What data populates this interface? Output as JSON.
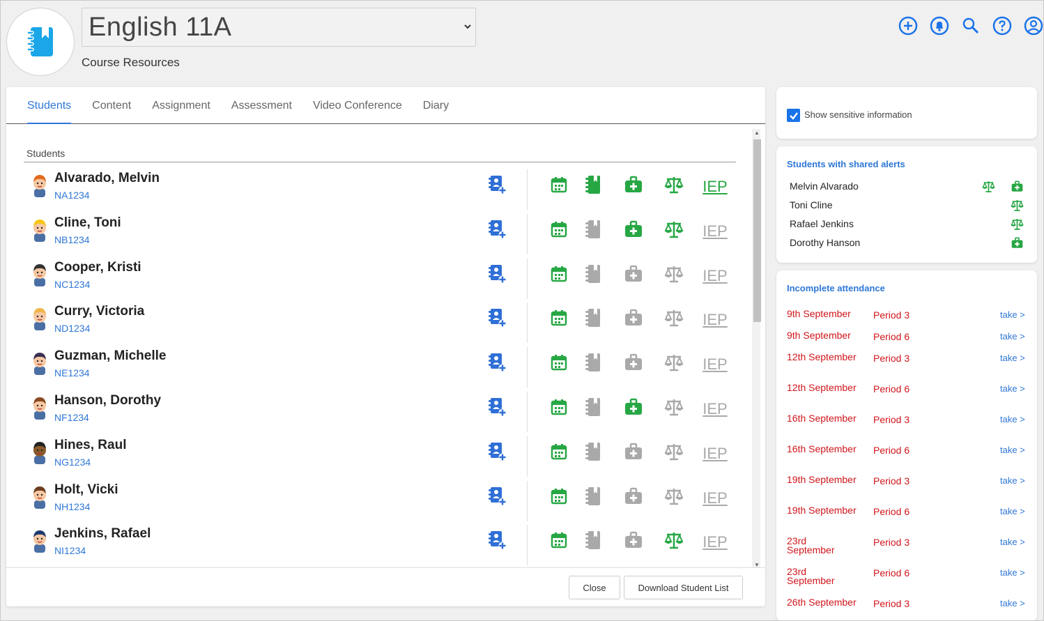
{
  "header": {
    "course_title": "English 11A",
    "subtitle": "Course Resources"
  },
  "colors": {
    "accent": "#2f77d6",
    "green": "#27a744",
    "grey": "#a9a9a9",
    "red": "#d0151b"
  },
  "top_icons": [
    "add-circle-icon",
    "bell-icon",
    "search-icon",
    "help-icon",
    "account-icon"
  ],
  "tabs": [
    {
      "label": "Students",
      "active": true
    },
    {
      "label": "Content"
    },
    {
      "label": "Assignment"
    },
    {
      "label": "Assessment"
    },
    {
      "label": "Video Conference"
    },
    {
      "label": "Diary"
    }
  ],
  "students_section": {
    "label": "Students",
    "iep_label": "IEP"
  },
  "students": [
    {
      "name": "Alvarado, Melvin",
      "id": "NA1234",
      "book": true,
      "medical": true,
      "legal": true,
      "iep": true
    },
    {
      "name": "Cline, Toni",
      "id": "NB1234",
      "book": false,
      "medical": true,
      "legal": true,
      "iep": false
    },
    {
      "name": "Cooper, Kristi",
      "id": "NC1234",
      "book": false,
      "medical": false,
      "legal": false,
      "iep": false
    },
    {
      "name": "Curry, Victoria",
      "id": "ND1234",
      "book": false,
      "medical": false,
      "legal": false,
      "iep": false
    },
    {
      "name": "Guzman, Michelle",
      "id": "NE1234",
      "book": false,
      "medical": false,
      "legal": false,
      "iep": false
    },
    {
      "name": "Hanson, Dorothy",
      "id": "NF1234",
      "book": false,
      "medical": true,
      "legal": false,
      "iep": false
    },
    {
      "name": "Hines, Raul",
      "id": "NG1234",
      "book": false,
      "medical": false,
      "legal": false,
      "iep": false
    },
    {
      "name": "Holt, Vicki",
      "id": "NH1234",
      "book": false,
      "medical": false,
      "legal": false,
      "iep": false
    },
    {
      "name": "Jenkins, Rafael",
      "id": "NI1234",
      "book": false,
      "medical": false,
      "legal": true,
      "iep": false
    }
  ],
  "footer": {
    "close_label": "Close",
    "download_label": "Download Student List"
  },
  "sensitive": {
    "label": "Show sensitive information",
    "checked": true
  },
  "shared_alerts": {
    "title": "Students with shared alerts",
    "items": [
      {
        "name": "Melvin Alvarado",
        "icons": [
          "scale-icon",
          "medical-kit-icon"
        ]
      },
      {
        "name": "Toni Cline",
        "icons": [
          "scale-icon"
        ]
      },
      {
        "name": "Rafael Jenkins",
        "icons": [
          "scale-icon"
        ]
      },
      {
        "name": "Dorothy Hanson",
        "icons": [
          "medical-kit-icon"
        ]
      }
    ]
  },
  "attendance": {
    "title": "Incomplete attendance",
    "take_label": "take >",
    "items": [
      {
        "date": "9th September",
        "period": "Period 3"
      },
      {
        "date": "9th September",
        "period": "Period 6"
      },
      {
        "date": "12th September",
        "period": "Period 3"
      },
      {
        "date": "12th September",
        "period": "Period 6"
      },
      {
        "date": "16th September",
        "period": "Period 3"
      },
      {
        "date": "16th September",
        "period": "Period 6"
      },
      {
        "date": "19th September",
        "period": "Period 3"
      },
      {
        "date": "19th September",
        "period": "Period 6"
      },
      {
        "date": "23rd September",
        "period": "Period 3"
      },
      {
        "date": "23rd September",
        "period": "Period 6"
      },
      {
        "date": "26th September",
        "period": "Period 3"
      }
    ]
  }
}
